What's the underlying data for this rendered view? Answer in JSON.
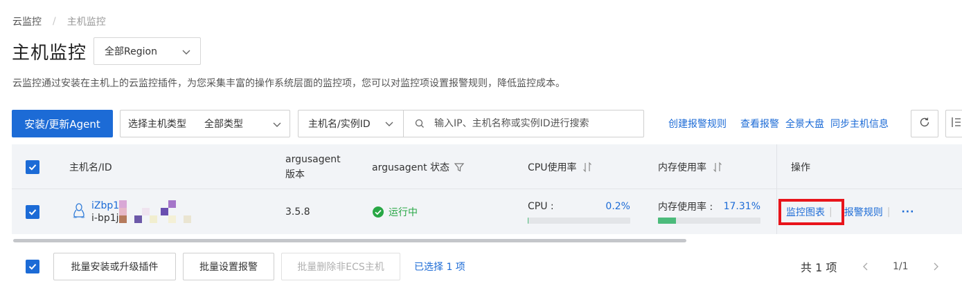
{
  "breadcrumb": {
    "root": "云监控",
    "separator": "/",
    "current": "主机监控"
  },
  "page": {
    "title": "主机监控",
    "region_select": "全部Region",
    "description": "云监控通过安装在主机上的云监控插件，为您采集丰富的操作系统层面的监控项，您可以对监控项设置报警规则，降低监控成本。"
  },
  "toolbar": {
    "install_button": "安装/更新Agent",
    "host_type_label": "选择主机类型",
    "host_type_value": "全部类型",
    "search_field": "主机名/实例ID",
    "search_placeholder": "输入IP、主机名称或实例ID进行搜索",
    "links": [
      "创建报警规则",
      "查看报警",
      "全景大盘",
      "同步主机信息"
    ]
  },
  "table": {
    "headers": {
      "host": "主机名/ID",
      "version_line1": "argusagent",
      "version_line2": "版本",
      "status": "argusagent 状态",
      "cpu": "CPU使用率",
      "memory": "内存使用率",
      "ops": "操作"
    },
    "rows": [
      {
        "host_name": "iZbp1",
        "host_id": "i-bp1j",
        "version": "3.5.8",
        "status": "运行中",
        "cpu_label": "CPU :",
        "cpu_value": "0.2%",
        "cpu_fraction": 0.002,
        "mem_label": "内存使用率 :",
        "mem_value": "17.31%",
        "mem_fraction": 0.1731,
        "op_monitor": "监控图表",
        "op_alarm": "报警规则",
        "op_more": "···"
      }
    ]
  },
  "footer": {
    "batch_install": "批量安装或升级插件",
    "batch_alarm": "批量设置报警",
    "batch_delete": "批量删除非ECS主机",
    "selected": "已选择 1 项",
    "total": "共 1 项",
    "page": "1/1"
  },
  "colors": {
    "primary": "#1c6bd6",
    "success": "#28a745",
    "highlight": "#e8141b",
    "bar_fill": "#4cbb7b"
  }
}
